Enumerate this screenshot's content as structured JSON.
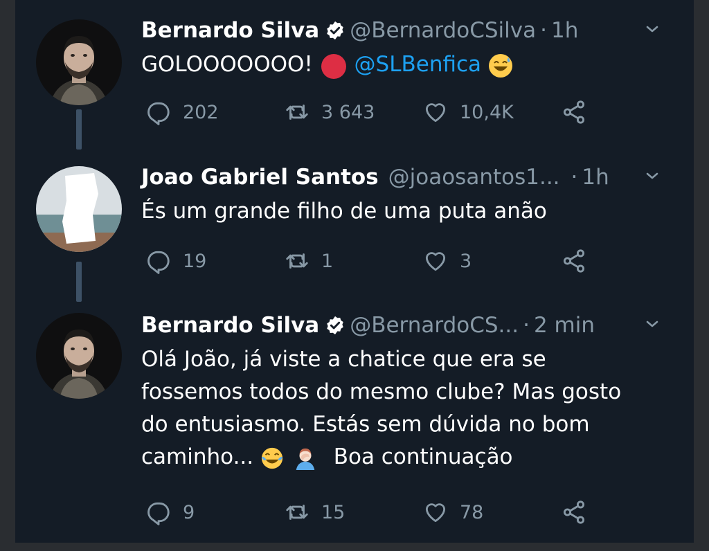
{
  "colors": {
    "background": "#141c26",
    "name": "#ffffff",
    "secondary": "#8899a6",
    "mention": "#1da1f2",
    "thread_line": "#3d5166",
    "verified": "#ffffff"
  },
  "tweets": [
    {
      "name": "Bernardo Silva",
      "verified": true,
      "handle": "@BernardoCSilva",
      "time": "1h",
      "text_before": "GOLOOOOOOO!",
      "mention": "@SLBenfica",
      "emojis": [
        "red-circle-emoji",
        "sweat-smile-emoji"
      ],
      "replies": "202",
      "retweets": "3 643",
      "likes": "10,4K"
    },
    {
      "name": "Joao Gabriel Santos",
      "verified": false,
      "handle": "@joaosantos1...",
      "time": "1h",
      "text": "És um grande filho de uma puta anão",
      "replies": "19",
      "retweets": "1",
      "likes": "3"
    },
    {
      "name": "Bernardo Silva",
      "verified": true,
      "handle": "@BernardoCS...",
      "time": "2 min",
      "line1": "Olá João, já viste a chatice que era se",
      "line2": "fossemos todos do mesmo clube? Mas gosto",
      "line3": "do entusiasmo. Estás sem dúvida no bom",
      "line4_before": "caminho...",
      "line4_after": "Boa continuação",
      "emojis": [
        "tears-of-joy-emoji",
        "facepalm-emoji"
      ],
      "replies": "9",
      "retweets": "15",
      "likes": "78"
    }
  ],
  "icons": {
    "reply": "reply-icon",
    "retweet": "retweet-icon",
    "like": "heart-icon",
    "share": "share-icon",
    "caret": "chevron-down-icon",
    "verified": "verified-badge-icon"
  }
}
